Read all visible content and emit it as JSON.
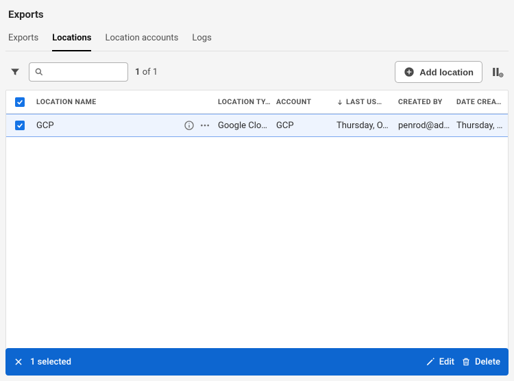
{
  "page": {
    "title": "Exports"
  },
  "tabs": {
    "items": [
      "Exports",
      "Locations",
      "Location accounts",
      "Logs"
    ],
    "active": 1
  },
  "toolbar": {
    "search_placeholder": "",
    "count_current": "1",
    "count_sep": " of ",
    "count_total": "1",
    "add_button": "Add location"
  },
  "columns": {
    "name": "Location Name",
    "type": "Location Ty…",
    "account": "Account",
    "last_used": "Last Us…",
    "created_by": "Created By",
    "date_created": "Date Created"
  },
  "rows": [
    {
      "name": "GCP",
      "type": "Google Clo…",
      "account": "GCP",
      "last_used": "Thursday, O…",
      "created_by": "penrod@ad…",
      "date_created": "Thursday, O…"
    }
  ],
  "footer": {
    "selected_text": "1 selected",
    "edit": "Edit",
    "delete": "Delete"
  }
}
